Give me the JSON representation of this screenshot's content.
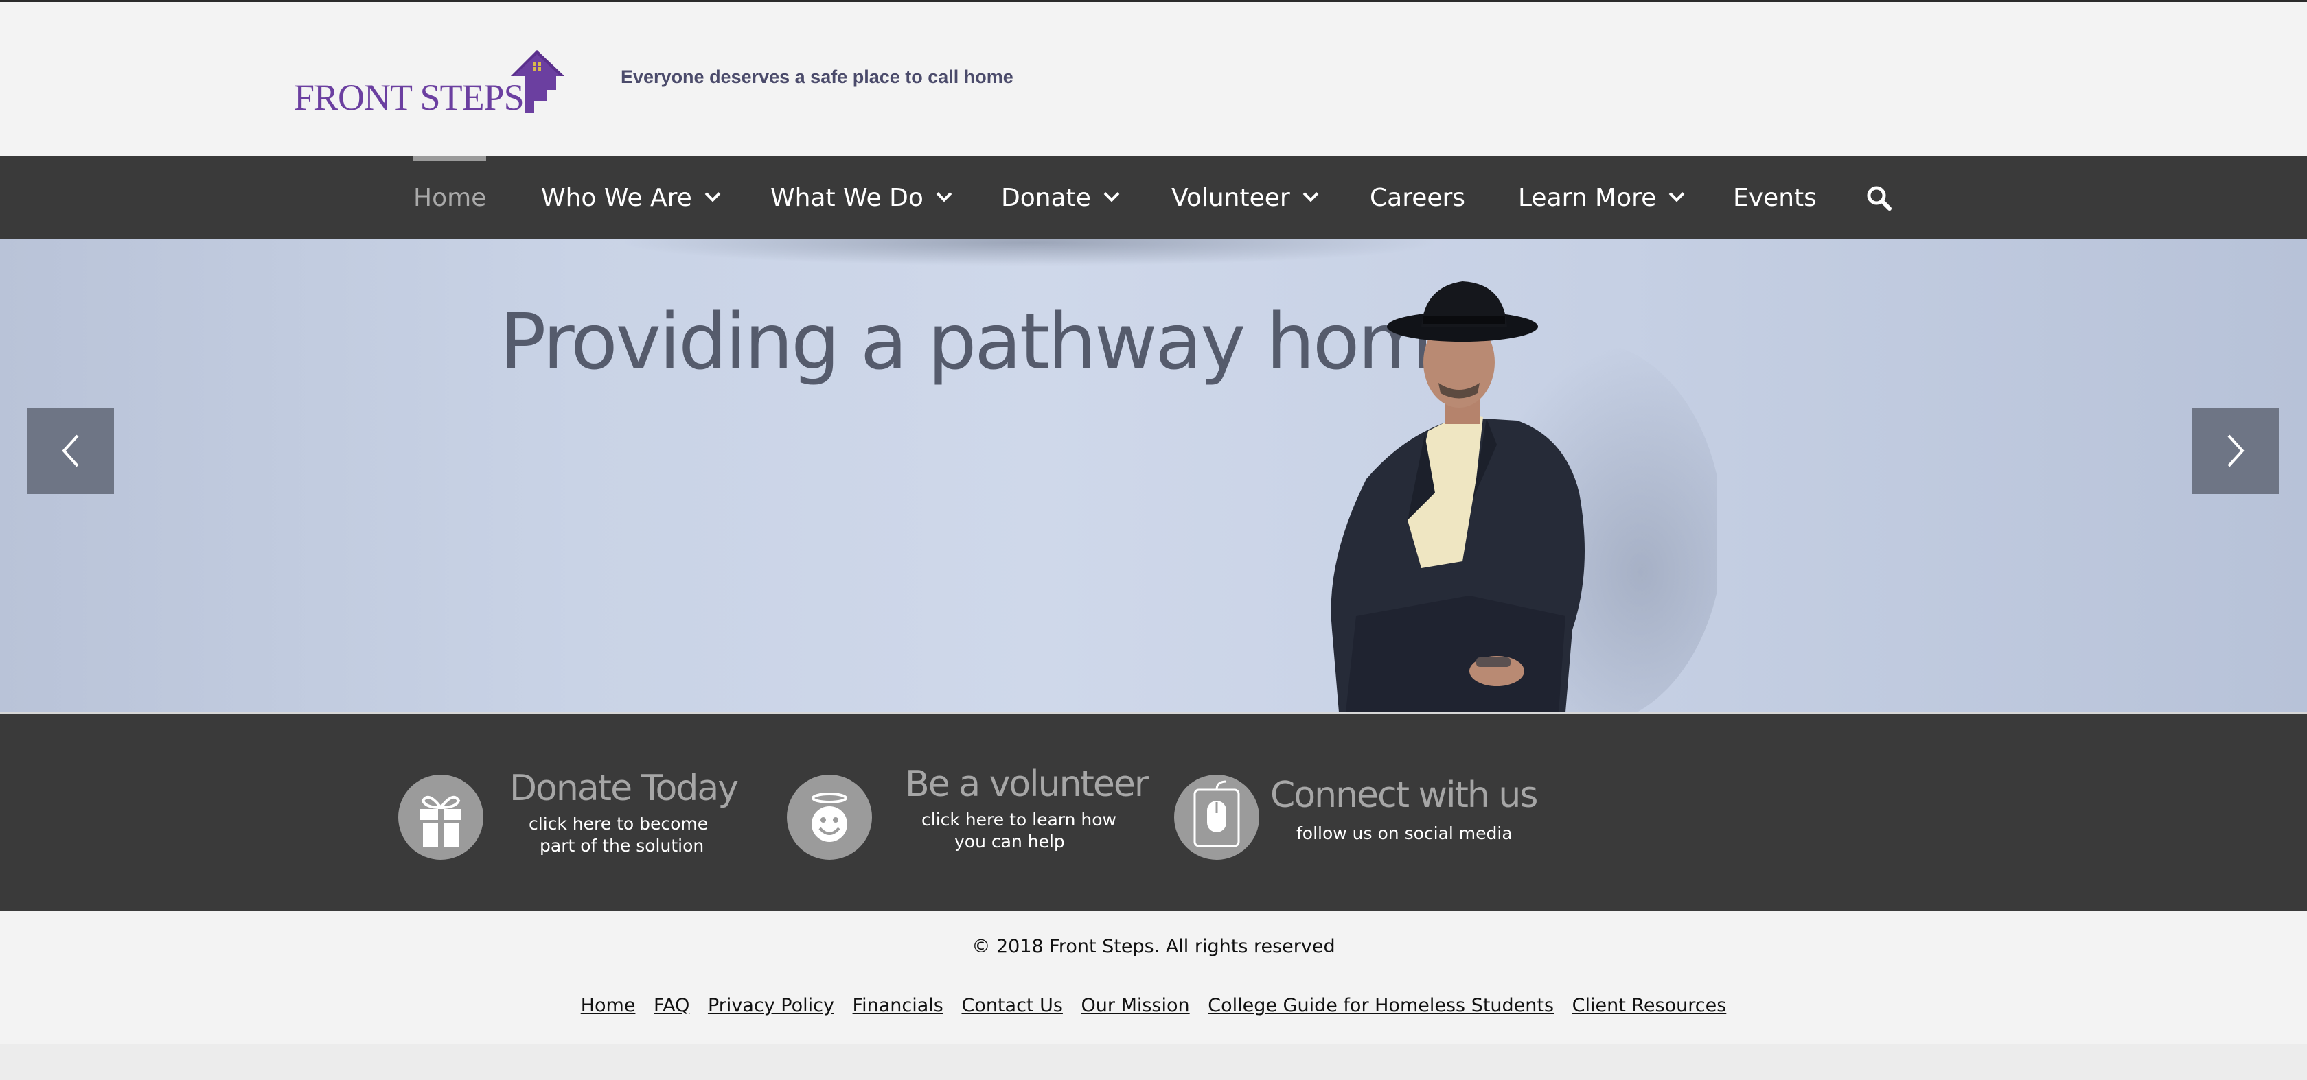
{
  "header": {
    "logo_text": "FRONT STEPS",
    "tagline": "Everyone deserves a safe place to call home",
    "brand_color": "#6b3fa0"
  },
  "nav": {
    "items": [
      {
        "label": "Home",
        "active": true,
        "dropdown": false
      },
      {
        "label": "Who We Are",
        "active": false,
        "dropdown": true
      },
      {
        "label": "What We Do",
        "active": false,
        "dropdown": true
      },
      {
        "label": "Donate",
        "active": false,
        "dropdown": true
      },
      {
        "label": "Volunteer",
        "active": false,
        "dropdown": true
      },
      {
        "label": "Careers",
        "active": false,
        "dropdown": false
      },
      {
        "label": "Learn More",
        "active": false,
        "dropdown": true
      },
      {
        "label": "Events",
        "active": false,
        "dropdown": false
      }
    ],
    "search_icon": "search-icon"
  },
  "hero": {
    "title": "Providing a pathway home",
    "prev_icon": "chevron-left-icon",
    "next_icon": "chevron-right-icon"
  },
  "cta": {
    "donate": {
      "title": "Donate Today",
      "line1": "click here to become",
      "line2": "part of the solution",
      "icon": "gift-icon"
    },
    "volunteer": {
      "title": "Be a volunteer",
      "line1": "click here to learn how",
      "line2": "you can help",
      "icon": "smiley-halo-icon"
    },
    "connect": {
      "title": "Connect with us",
      "line1": "follow us on social media",
      "icon": "mouse-icon"
    }
  },
  "footer": {
    "copyright": "© 2018 Front Steps. All rights reserved",
    "links": [
      "Home",
      "FAQ",
      "Privacy Policy",
      "Financials",
      "Contact Us",
      "Our Mission",
      "College Guide for Homeless Students",
      "Client Resources"
    ]
  }
}
